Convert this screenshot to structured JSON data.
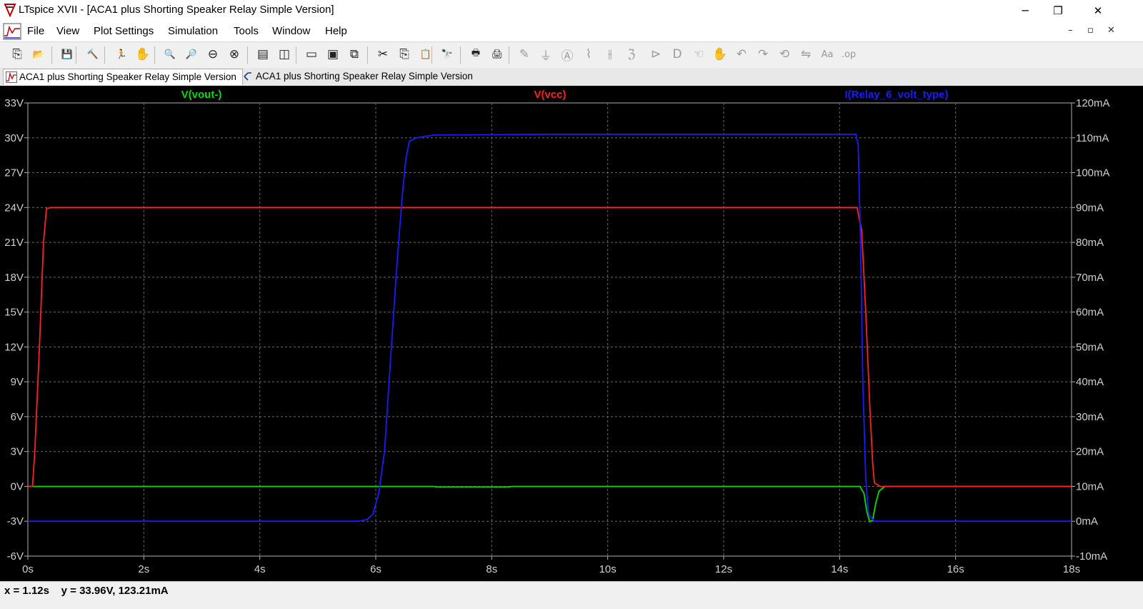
{
  "window": {
    "title": "LTspice XVII - [ACA1 plus Shorting Speaker Relay Simple Version]",
    "minimize_glyph": "─",
    "maximize_glyph": "❐",
    "close_glyph": "✕"
  },
  "menubar": {
    "items": [
      {
        "label": "File"
      },
      {
        "label": "View"
      },
      {
        "label": "Plot Settings"
      },
      {
        "label": "Simulation"
      },
      {
        "label": "Tools"
      },
      {
        "label": "Window"
      },
      {
        "label": "Help"
      }
    ],
    "mdi_minimize": "–",
    "mdi_restore": "▫",
    "mdi_close": "✕"
  },
  "toolbar": {
    "buttons": [
      {
        "icon": "new-schematic-icon",
        "glyph": "⎘"
      },
      {
        "icon": "open-icon",
        "glyph": "📂"
      },
      {
        "icon": "save-icon",
        "glyph": "💾"
      },
      {
        "icon": "control-panel-icon",
        "glyph": "🔨"
      },
      {
        "icon": "run-icon",
        "glyph": "🏃"
      },
      {
        "icon": "halt-icon",
        "glyph": "✋"
      },
      {
        "icon": "zoom-area-icon",
        "glyph": "🔍"
      },
      {
        "icon": "pan-icon",
        "glyph": "🔎"
      },
      {
        "icon": "zoom-back-icon",
        "glyph": "⊖"
      },
      {
        "icon": "zoom-fit-icon",
        "glyph": "⊗"
      },
      {
        "icon": "autorange-icon",
        "glyph": "▤"
      },
      {
        "icon": "cursor-icon",
        "glyph": "◫"
      },
      {
        "icon": "tile-horizontal-icon",
        "glyph": "▭"
      },
      {
        "icon": "cascade-icon",
        "glyph": "▣"
      },
      {
        "icon": "close-windows-icon",
        "glyph": "⧉"
      },
      {
        "icon": "cut-icon",
        "glyph": "✂"
      },
      {
        "icon": "copy-icon",
        "glyph": "⎘"
      },
      {
        "icon": "paste-icon",
        "glyph": "📋"
      },
      {
        "icon": "find-icon",
        "glyph": "🔭"
      },
      {
        "icon": "print-preview-icon",
        "glyph": "🖶"
      },
      {
        "icon": "print-icon",
        "glyph": "🖨"
      },
      {
        "icon": "wire-icon",
        "glyph": "✎"
      },
      {
        "icon": "ground-icon",
        "glyph": "⏚"
      },
      {
        "icon": "label-icon",
        "glyph": "Ⓐ"
      },
      {
        "icon": "resistor-icon",
        "glyph": "⌇"
      },
      {
        "icon": "capacitor-icon",
        "glyph": "⫲"
      },
      {
        "icon": "inductor-icon",
        "glyph": "ℨ"
      },
      {
        "icon": "diode-icon",
        "glyph": "⊳"
      },
      {
        "icon": "component-icon",
        "glyph": "D"
      },
      {
        "icon": "move-icon",
        "glyph": "☜"
      },
      {
        "icon": "drag-icon",
        "glyph": "✋"
      },
      {
        "icon": "undo-icon",
        "glyph": "↶"
      },
      {
        "icon": "redo-icon",
        "glyph": "↷"
      },
      {
        "icon": "rotate-icon",
        "glyph": "⟲"
      },
      {
        "icon": "mirror-icon",
        "glyph": "⇋"
      },
      {
        "icon": "text-icon",
        "glyph": "Aa"
      },
      {
        "icon": "spice-directive-icon",
        "glyph": ".op"
      }
    ]
  },
  "tabs": [
    {
      "label": "ACA1 plus Shorting Speaker Relay Simple Version",
      "icon": "waveform-icon",
      "active": true
    },
    {
      "label": "ACA1 plus Shorting Speaker Relay Simple Version",
      "icon": "schematic-icon",
      "active": false
    }
  ],
  "status": {
    "text": "x = 1.12s    y = 33.96V, 123.21mA"
  },
  "chart_data": {
    "type": "line",
    "x_unit": "s",
    "xlim": [
      0,
      18
    ],
    "x_ticks": [
      {
        "value": 0,
        "label": "0s"
      },
      {
        "value": 2,
        "label": "2s"
      },
      {
        "value": 4,
        "label": "4s"
      },
      {
        "value": 6,
        "label": "6s"
      },
      {
        "value": 8,
        "label": "8s"
      },
      {
        "value": 10,
        "label": "10s"
      },
      {
        "value": 12,
        "label": "12s"
      },
      {
        "value": 14,
        "label": "14s"
      },
      {
        "value": 16,
        "label": "16s"
      },
      {
        "value": 18,
        "label": "18s"
      }
    ],
    "y_left": {
      "unit": "V",
      "lim": [
        -6,
        33
      ],
      "ticks": [
        {
          "value": 33,
          "label": "33V"
        },
        {
          "value": 30,
          "label": "30V"
        },
        {
          "value": 27,
          "label": "27V"
        },
        {
          "value": 24,
          "label": "24V"
        },
        {
          "value": 21,
          "label": "21V"
        },
        {
          "value": 18,
          "label": "18V"
        },
        {
          "value": 15,
          "label": "15V"
        },
        {
          "value": 12,
          "label": "12V"
        },
        {
          "value": 9,
          "label": "9V"
        },
        {
          "value": 6,
          "label": "6V"
        },
        {
          "value": 3,
          "label": "3V"
        },
        {
          "value": 0,
          "label": "0V"
        },
        {
          "value": -3,
          "label": "-3V"
        },
        {
          "value": -6,
          "label": "-6V"
        }
      ]
    },
    "y_right": {
      "unit": "mA",
      "lim": [
        -10,
        120
      ],
      "ticks": [
        {
          "value": 120,
          "label": "120mA"
        },
        {
          "value": 110,
          "label": "110mA"
        },
        {
          "value": 100,
          "label": "100mA"
        },
        {
          "value": 90,
          "label": "90mA"
        },
        {
          "value": 80,
          "label": "80mA"
        },
        {
          "value": 70,
          "label": "70mA"
        },
        {
          "value": 60,
          "label": "60mA"
        },
        {
          "value": 50,
          "label": "50mA"
        },
        {
          "value": 40,
          "label": "40mA"
        },
        {
          "value": 30,
          "label": "30mA"
        },
        {
          "value": 20,
          "label": "20mA"
        },
        {
          "value": 10,
          "label": "10mA"
        },
        {
          "value": 0,
          "label": "0mA"
        },
        {
          "value": -10,
          "label": "-10mA"
        }
      ]
    },
    "grid": true,
    "series": [
      {
        "name": "V(vout-)",
        "color": "#00e000",
        "axis": "left",
        "points": [
          [
            0,
            0
          ],
          [
            7,
            0
          ],
          [
            7.05,
            -0.05
          ],
          [
            8.3,
            -0.05
          ],
          [
            8.35,
            0
          ],
          [
            14.35,
            0
          ],
          [
            14.42,
            -0.6
          ],
          [
            14.47,
            -2.2
          ],
          [
            14.52,
            -3.05
          ],
          [
            14.57,
            -2.9
          ],
          [
            14.62,
            -1.5
          ],
          [
            14.68,
            -0.4
          ],
          [
            14.78,
            0
          ],
          [
            18,
            0
          ]
        ]
      },
      {
        "name": "V(vcc)",
        "color": "#ff2020",
        "axis": "left",
        "points": [
          [
            0,
            0
          ],
          [
            0.08,
            0
          ],
          [
            0.12,
            3
          ],
          [
            0.2,
            12
          ],
          [
            0.27,
            21
          ],
          [
            0.32,
            23.9
          ],
          [
            0.4,
            24
          ],
          [
            14.3,
            24
          ],
          [
            14.38,
            22
          ],
          [
            14.45,
            15
          ],
          [
            14.52,
            7
          ],
          [
            14.57,
            2
          ],
          [
            14.6,
            0.3
          ],
          [
            14.7,
            0
          ],
          [
            18,
            0
          ]
        ]
      },
      {
        "name": "I(Relay_6_volt_type)",
        "color": "#1a1aff",
        "axis": "right",
        "points": [
          [
            0,
            0
          ],
          [
            5.7,
            0
          ],
          [
            5.85,
            0.5
          ],
          [
            5.95,
            2
          ],
          [
            6.05,
            8
          ],
          [
            6.15,
            20
          ],
          [
            6.25,
            45
          ],
          [
            6.35,
            70
          ],
          [
            6.45,
            92
          ],
          [
            6.52,
            104
          ],
          [
            6.58,
            109
          ],
          [
            6.7,
            110
          ],
          [
            7.0,
            110.8
          ],
          [
            9,
            111
          ],
          [
            13,
            111
          ],
          [
            14.28,
            111
          ],
          [
            14.32,
            108
          ],
          [
            14.36,
            80
          ],
          [
            14.4,
            40
          ],
          [
            14.45,
            12
          ],
          [
            14.5,
            2
          ],
          [
            14.6,
            0
          ],
          [
            18,
            0
          ]
        ]
      }
    ]
  }
}
